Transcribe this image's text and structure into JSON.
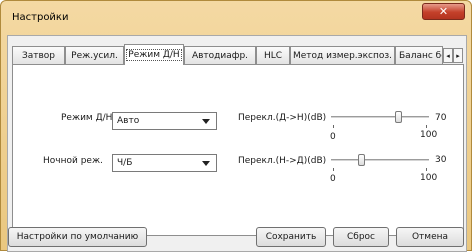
{
  "window": {
    "title": "Настройки",
    "close_label": "✕"
  },
  "tabs": [
    {
      "label": "Затвор"
    },
    {
      "label": "Реж.усил."
    },
    {
      "label": "Режим Д/Н"
    },
    {
      "label": "Автодиафр."
    },
    {
      "label": "HLC"
    },
    {
      "label": "Метод измер.экспоз."
    },
    {
      "label": "Баланс бел."
    }
  ],
  "tab_scroll": {
    "left": "◂",
    "right": "▸"
  },
  "day_night": {
    "mode_label": "Режим Д/Н",
    "mode_value": "Авто",
    "night_label": "Ночной реж.",
    "night_value": "Ч/Б"
  },
  "sliders": [
    {
      "label": "Перекл.(Д->Н)(dB)",
      "value": 70,
      "min": 0,
      "max": 100,
      "value_text": "70",
      "min_text": "0",
      "max_text": "100"
    },
    {
      "label": "Перекл.(Н->Д)(dB)",
      "value": 30,
      "min": 0,
      "max": 100,
      "value_text": "30",
      "min_text": "0",
      "max_text": "100"
    }
  ],
  "buttons": {
    "defaults": "Настройки по умолчанию",
    "save": "Сохранить",
    "reset": "Сброс",
    "cancel": "Отмена"
  }
}
